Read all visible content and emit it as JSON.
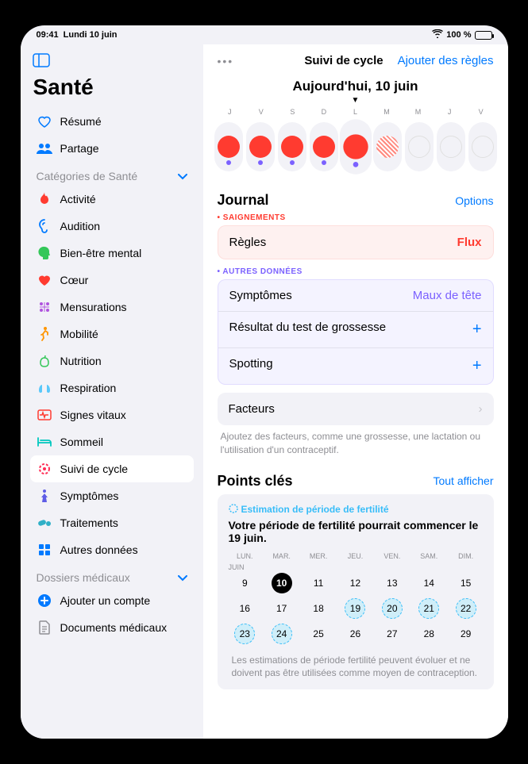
{
  "status": {
    "time": "09:41",
    "date": "Lundi 10 juin",
    "battery": "100 %"
  },
  "app_title": "Santé",
  "nav_top": [
    {
      "label": "Résumé",
      "icon": "heart-outline",
      "color": "#007aff"
    },
    {
      "label": "Partage",
      "icon": "people",
      "color": "#007aff"
    }
  ],
  "categories_header": "Catégories de Santé",
  "categories": [
    {
      "label": "Activité",
      "icon": "flame",
      "color": "#ff3b30"
    },
    {
      "label": "Audition",
      "icon": "ear",
      "color": "#007aff"
    },
    {
      "label": "Bien-être mental",
      "icon": "head",
      "color": "#34c759"
    },
    {
      "label": "Cœur",
      "icon": "heart",
      "color": "#ff3b30"
    },
    {
      "label": "Mensurations",
      "icon": "ruler",
      "color": "#af52de"
    },
    {
      "label": "Mobilité",
      "icon": "walk",
      "color": "#ff9500"
    },
    {
      "label": "Nutrition",
      "icon": "apple",
      "color": "#34c759"
    },
    {
      "label": "Respiration",
      "icon": "lungs",
      "color": "#5ac8fa"
    },
    {
      "label": "Signes vitaux",
      "icon": "vitals",
      "color": "#ff3b30"
    },
    {
      "label": "Sommeil",
      "icon": "bed",
      "color": "#00c7be"
    },
    {
      "label": "Suivi de cycle",
      "icon": "cycle",
      "color": "#ff2d55",
      "selected": true
    },
    {
      "label": "Symptômes",
      "icon": "person-sym",
      "color": "#5e5ce6"
    },
    {
      "label": "Traitements",
      "icon": "pills",
      "color": "#30b0c7"
    },
    {
      "label": "Autres données",
      "icon": "grid",
      "color": "#007aff"
    }
  ],
  "records_header": "Dossiers médicaux",
  "records": [
    {
      "label": "Ajouter un compte",
      "icon": "plus-circle",
      "color": "#007aff"
    },
    {
      "label": "Documents médicaux",
      "icon": "doc",
      "color": "#8e8e93"
    }
  ],
  "main": {
    "header_title": "Suivi de cycle",
    "header_action": "Ajouter des règles",
    "today_title": "Aujourd'hui, 10 juin",
    "day_initials": [
      "J",
      "V",
      "S",
      "D",
      "L",
      "M",
      "M",
      "J",
      "V"
    ],
    "strip": [
      {
        "period": "filled",
        "sym": true
      },
      {
        "period": "filled",
        "sym": true
      },
      {
        "period": "filled",
        "sym": true
      },
      {
        "period": "filled",
        "sym": true
      },
      {
        "period": "filled",
        "sym": true,
        "today": true
      },
      {
        "period": "hatch",
        "sym": false
      },
      {
        "period": "empty",
        "sym": false
      },
      {
        "period": "empty",
        "sym": false
      },
      {
        "period": "empty",
        "sym": false
      }
    ],
    "journal_title": "Journal",
    "journal_options": "Options",
    "bleeding_label": "SAIGNEMENTS",
    "period_row": {
      "label": "Règles",
      "value": "Flux"
    },
    "other_label": "AUTRES DONNÉES",
    "other_rows": [
      {
        "label": "Symptômes",
        "value": "Maux de tête"
      },
      {
        "label": "Résultat du test de grossesse",
        "value": "+"
      },
      {
        "label": "Spotting",
        "value": "+"
      }
    ],
    "factors_label": "Facteurs",
    "factors_hint": "Ajoutez des facteurs, comme une grossesse, une lactation ou l'utilisation d'un contraceptif.",
    "keypoints_title": "Points clés",
    "keypoints_action": "Tout afficher",
    "fertile_label": "Estimation de période de fertilité",
    "fertile_desc": "Votre période de fertilité pourrait commencer le 19 juin.",
    "cal_days": [
      "lun.",
      "mar.",
      "mer.",
      "jeu.",
      "ven.",
      "sam.",
      "dim."
    ],
    "cal_month": "JUIN",
    "calendar": [
      [
        {
          "n": 9
        },
        {
          "n": 10,
          "today": true
        },
        {
          "n": 11
        },
        {
          "n": 12
        },
        {
          "n": 13
        },
        {
          "n": 14
        },
        {
          "n": 15
        }
      ],
      [
        {
          "n": 16
        },
        {
          "n": 17
        },
        {
          "n": 18
        },
        {
          "n": 19,
          "f": true
        },
        {
          "n": 20,
          "f": true
        },
        {
          "n": 21,
          "f": true
        },
        {
          "n": 22,
          "f": true
        }
      ],
      [
        {
          "n": 23,
          "f": true
        },
        {
          "n": 24,
          "f": true
        },
        {
          "n": 25
        },
        {
          "n": 26
        },
        {
          "n": 27
        },
        {
          "n": 28
        },
        {
          "n": 29
        }
      ]
    ],
    "cal_hint": "Les estimations de période fertilité peuvent évoluer et ne doivent pas être utilisées comme moyen de contraception."
  }
}
